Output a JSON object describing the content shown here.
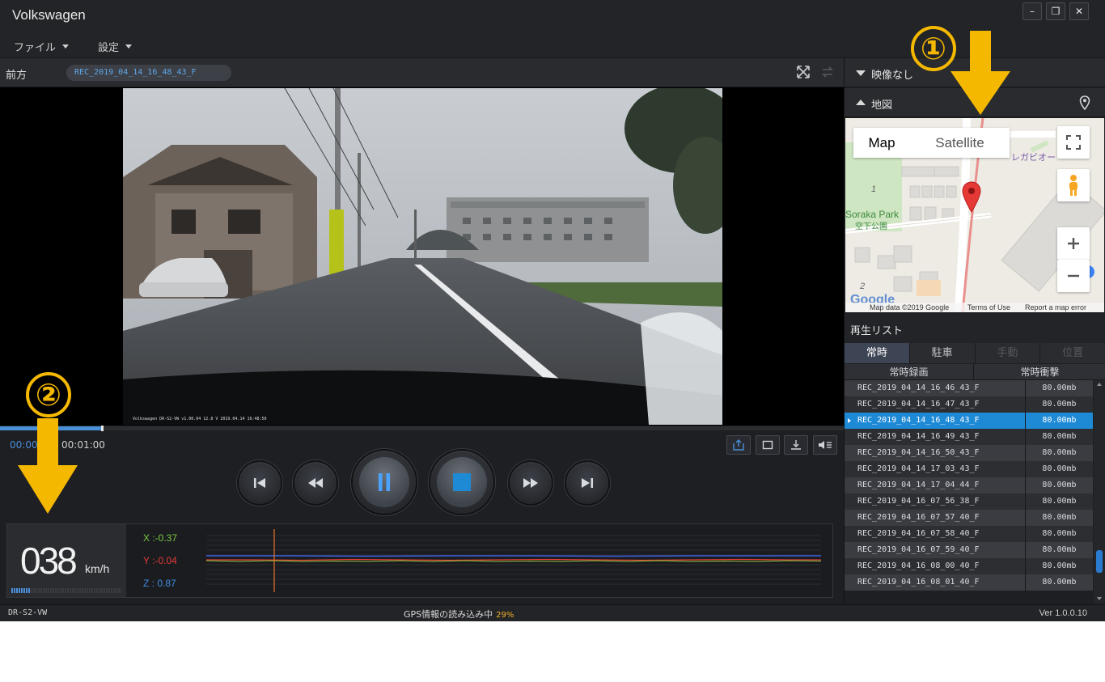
{
  "window": {
    "title": "Volkswagen",
    "minimize": "–",
    "restore": "❐",
    "close": "✕"
  },
  "menu": {
    "file": "ファイル",
    "settings": "設定"
  },
  "video_header": {
    "view_label": "前方",
    "current_file": "REC_2019_04_14_16_48_43_F"
  },
  "video": {
    "overlay_text": "Volkswagen DR-S2-VW   v1.00.04   12.8 V                                  2019.04.14 16:48:50"
  },
  "playback": {
    "progress_fraction": 0.12,
    "time_current": "00:00",
    "time_total": "00:01:00"
  },
  "telemetry": {
    "speed": "038",
    "speed_unit": "km/h",
    "speed_bar_fraction": 0.18,
    "x_label": "X :-0.37",
    "y_label": "Y :-0.04",
    "z_label": "Z : 0.87",
    "colors": {
      "x": "#7ac943",
      "y": "#e23b3b",
      "z": "#3d8de0",
      "marker": "#e8732a"
    }
  },
  "status": {
    "device": "DR-S2-VW",
    "gps_text": "GPS情報の読み込み中",
    "gps_percent": "29%",
    "version": "Ver 1.0.0.10"
  },
  "right_panel": {
    "video_section": "映像なし",
    "map_section": "地図",
    "map": {
      "tab_map": "Map",
      "tab_satellite": "Satellite",
      "place_park": "Soraka Park",
      "place_park_jp": "空下公園",
      "place_shop": "レガビオー",
      "number_1": "1",
      "number_2": "2",
      "attribution": "Map data ©2019 Google",
      "terms": "Terms of Use",
      "report": "Report a map error",
      "google": "Google"
    },
    "playlist_title": "再生リスト",
    "tabs": [
      "常時",
      "駐車",
      "手動",
      "位置"
    ],
    "subheads": [
      "常時録画",
      "常時衝撃"
    ],
    "files": [
      {
        "name": "REC_2019_04_14_16_46_43_F",
        "size": "80.00mb"
      },
      {
        "name": "REC_2019_04_14_16_47_43_F",
        "size": "80.00mb"
      },
      {
        "name": "REC_2019_04_14_16_48_43_F",
        "size": "80.00mb"
      },
      {
        "name": "REC_2019_04_14_16_49_43_F",
        "size": "80.00mb"
      },
      {
        "name": "REC_2019_04_14_16_50_43_F",
        "size": "80.00mb"
      },
      {
        "name": "REC_2019_04_14_17_03_43_F",
        "size": "80.00mb"
      },
      {
        "name": "REC_2019_04_14_17_04_44_F",
        "size": "80.00mb"
      },
      {
        "name": "REC_2019_04_16_07_56_38_F",
        "size": "80.00mb"
      },
      {
        "name": "REC_2019_04_16_07_57_40_F",
        "size": "80.00mb"
      },
      {
        "name": "REC_2019_04_16_07_58_40_F",
        "size": "80.00mb"
      },
      {
        "name": "REC_2019_04_16_07_59_40_F",
        "size": "80.00mb"
      },
      {
        "name": "REC_2019_04_16_08_00_40_F",
        "size": "80.00mb"
      },
      {
        "name": "REC_2019_04_16_08_01_40_F",
        "size": "80.00mb"
      }
    ],
    "selected_index": 2
  },
  "callouts": {
    "one": "①",
    "two": "②",
    "color": "#f5b800"
  }
}
